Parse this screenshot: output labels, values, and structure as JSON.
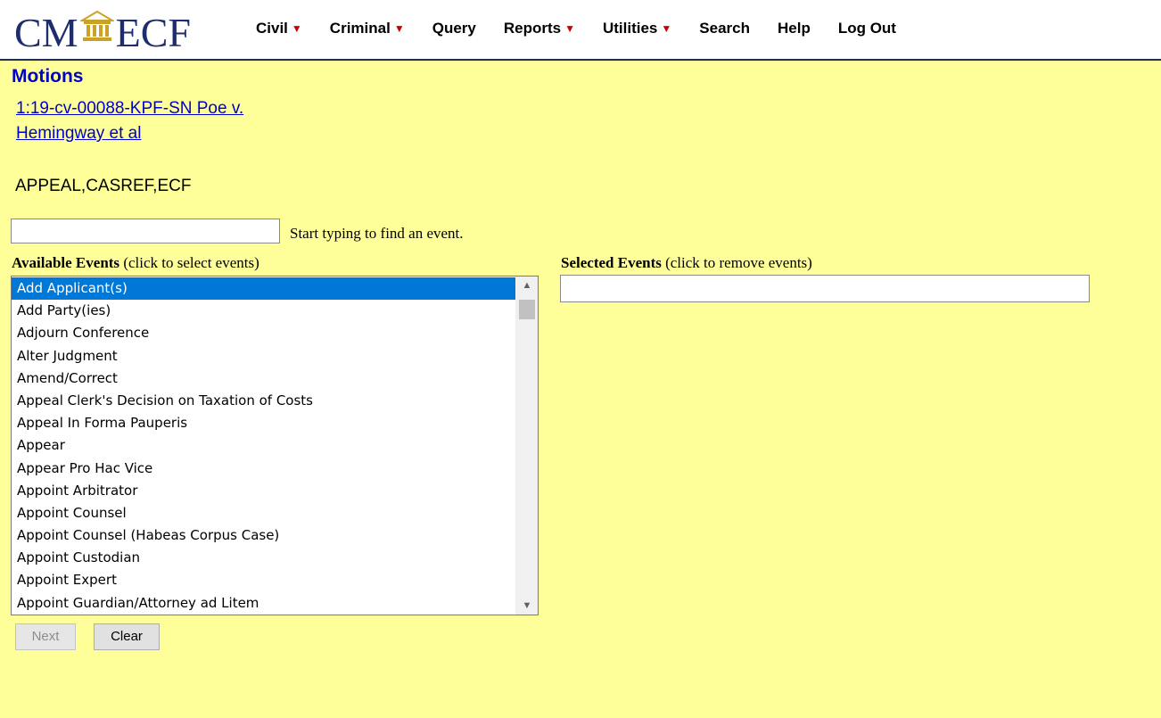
{
  "header": {
    "logo_left": "CM",
    "logo_right": "ECF",
    "menu": [
      {
        "label": "Civil",
        "dropdown": true
      },
      {
        "label": "Criminal",
        "dropdown": true
      },
      {
        "label": "Query",
        "dropdown": false
      },
      {
        "label": "Reports",
        "dropdown": true
      },
      {
        "label": "Utilities",
        "dropdown": true
      },
      {
        "label": "Search",
        "dropdown": false
      },
      {
        "label": "Help",
        "dropdown": false
      },
      {
        "label": "Log Out",
        "dropdown": false
      }
    ]
  },
  "page": {
    "title": "Motions",
    "case_link_line1": "1:19-cv-00088-KPF-SN Poe v.",
    "case_link_line2": "Hemingway et al",
    "case_flags": "APPEAL,CASREF,ECF"
  },
  "event_search": {
    "value": "",
    "hint": "Start typing to find an event."
  },
  "available_events": {
    "label_bold": "Available Events",
    "label_rest": " (click to select events)",
    "items": [
      "Add Applicant(s)",
      "Add Party(ies)",
      "Adjourn Conference",
      "Alter Judgment",
      "Amend/Correct",
      "Appeal Clerk's Decision on Taxation of Costs",
      "Appeal In Forma Pauperis",
      "Appear",
      "Appear Pro Hac Vice",
      "Appoint Arbitrator",
      "Appoint Counsel",
      "Appoint Counsel (Habeas Corpus Case)",
      "Appoint Custodian",
      "Appoint Expert",
      "Appoint Guardian/Attorney ad Litem"
    ],
    "selected_index": 0
  },
  "selected_events": {
    "label_bold": "Selected Events",
    "label_rest": " (click to remove events)"
  },
  "buttons": {
    "next": "Next",
    "clear": "Clear"
  },
  "colors": {
    "page_background": "#ffff99",
    "link": "#0000cc",
    "logo": "#1d2d6e",
    "caret": "#cc0000",
    "selection": "#0078d7"
  }
}
